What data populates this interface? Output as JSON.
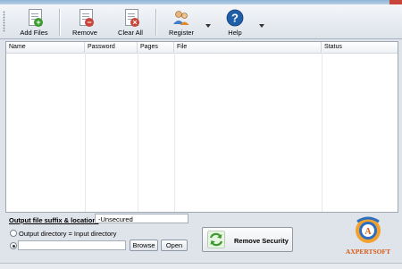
{
  "toolbar": {
    "add_files": "Add Files",
    "remove": "Remove",
    "clear_all": "Clear All",
    "register": "Register",
    "help": "Help"
  },
  "grid": {
    "columns": [
      "Name",
      "Password",
      "Pages",
      "File",
      "Status"
    ],
    "rows": []
  },
  "output": {
    "suffix_label": "Output file suffix & location:",
    "suffix_value": "-Unsecured",
    "same_dir_label": "Output directory = Input directory",
    "custom_dir_value": "",
    "browse": "Browse",
    "open": "Open"
  },
  "remove_security": "Remove Security",
  "brand": "AXPERTSOFT",
  "colors": {
    "accent_green": "#3c9a2e",
    "brand_orange": "#d85a14",
    "help_blue": "#1f5fa8",
    "danger_red": "#c9453a"
  }
}
